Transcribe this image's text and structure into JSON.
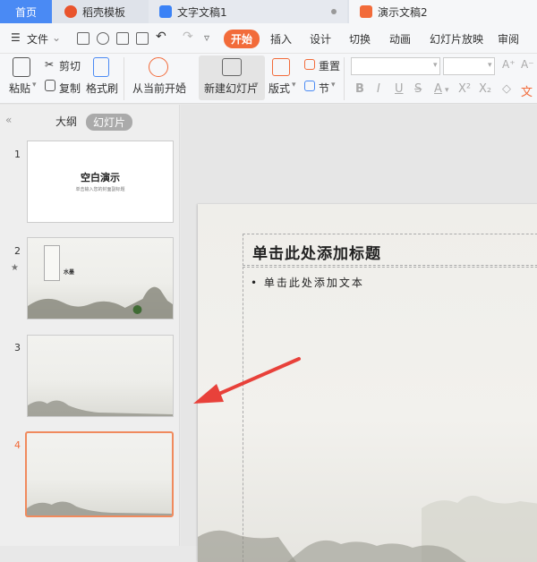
{
  "tabs": [
    {
      "label": "首页",
      "active": true
    },
    {
      "label": "稻壳模板",
      "icon": "daoke-icon",
      "icon_color": "#e9542d"
    },
    {
      "label": "文字文稿1",
      "icon": "writer-icon",
      "icon_color": "#3b82f6"
    },
    {
      "label": "演示文稿2",
      "icon": "presentation-icon",
      "icon_color": "#f26b3a"
    }
  ],
  "menubar": {
    "file": "文件",
    "items": [
      "开始",
      "插入",
      "设计",
      "切换",
      "动画",
      "幻灯片放映",
      "审阅"
    ],
    "active": "开始"
  },
  "ribbon": {
    "paste": "粘贴",
    "cut": "剪切",
    "copy": "复制",
    "format_painter": "格式刷",
    "from_current": "从当前开始",
    "new_slide": "新建幻灯片",
    "layout": "版式",
    "reset": "重置",
    "section": "节"
  },
  "sidebar": {
    "outline_tab": "大纲",
    "slides_tab": "幻灯片",
    "slides": [
      {
        "number": "1",
        "title": "空白演示",
        "subtitle": "单击输入您的封面副标题"
      },
      {
        "number": "2",
        "caption": "水墨",
        "has_animation": true
      },
      {
        "number": "3"
      },
      {
        "number": "4",
        "selected": true
      }
    ]
  },
  "slide": {
    "title_placeholder": "单击此处添加标题",
    "body_placeholder": "•  单击此处添加文本"
  },
  "colors": {
    "accent": "#f26b3a",
    "tab_active": "#4a8af4",
    "annotation_arrow": "#e8413a"
  }
}
